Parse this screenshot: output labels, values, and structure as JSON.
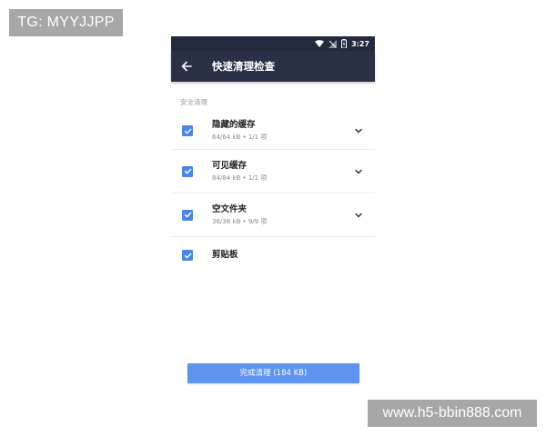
{
  "watermarks": {
    "top_left": "TG: MYYJJPP",
    "bottom_right": "www.h5-bbin888.com"
  },
  "status_bar": {
    "time": "3:27",
    "icons": [
      "wifi-icon",
      "no-signal-icon",
      "battery-icon"
    ]
  },
  "app_bar": {
    "back_icon": "arrow-left-icon",
    "title": "快速清理检查"
  },
  "section": {
    "header": "安全清理"
  },
  "items": [
    {
      "title": "隐藏的缓存",
      "subtitle": "64/64 kB • 1/1 项",
      "checked": true,
      "expandable": true
    },
    {
      "title": "可见缓存",
      "subtitle": "84/84 kB • 1/1 项",
      "checked": true,
      "expandable": true
    },
    {
      "title": "空文件夹",
      "subtitle": "36/36 kB • 9/9 项",
      "checked": true,
      "expandable": true
    },
    {
      "title": "剪贴板",
      "subtitle": "",
      "checked": true,
      "expandable": false
    }
  ],
  "action": {
    "done_label": "完成清理 (184 KB)"
  },
  "colors": {
    "status_bar": "#242a3d",
    "app_bar": "#2a3146",
    "accent": "#4a86e8",
    "button": "#5f93f0",
    "watermark_bg": "#a7a7a7"
  }
}
